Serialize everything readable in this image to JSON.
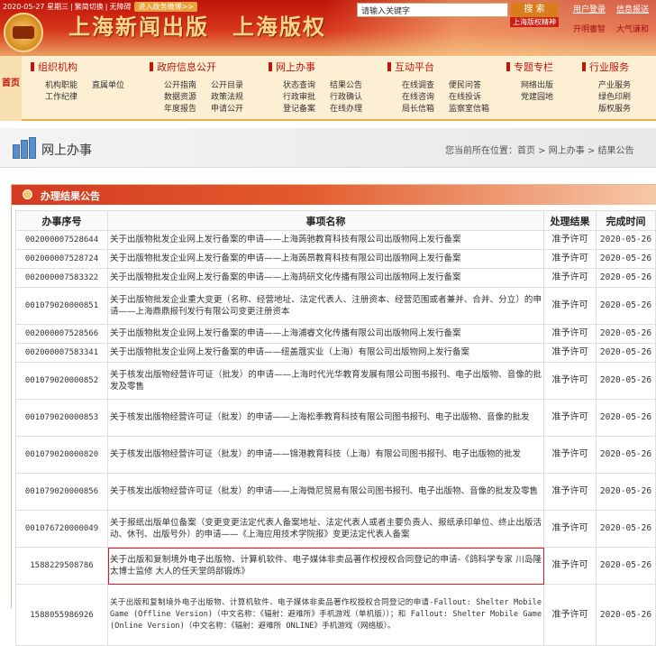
{
  "header": {
    "date_line": "2020-05-27 星期三",
    "lang_switch": "繁简切换",
    "accessible": "无障碍",
    "gov_entry": "进入政务微博>>",
    "title_publish": "上海新闻出版",
    "title_copyright": "上海版权",
    "search_placeholder": "请输入关键字",
    "search_button": "搜 索",
    "book_wall": "上海版权精神",
    "top_links": [
      "用户登录",
      "信息报送",
      "开明書智",
      "大气谦和"
    ]
  },
  "nav": {
    "home": "首页",
    "groups": [
      {
        "title": "组织机构",
        "links": [
          "机构职能",
          "直属单位",
          "工作纪律"
        ]
      },
      {
        "title": "政府信息公开",
        "links": [
          "公开指南",
          "公开目录",
          "数据资源",
          "政策法规",
          "年度报告",
          "申请公开"
        ]
      },
      {
        "title": "网上办事",
        "links": [
          "状态查询",
          "结果公告",
          "行政审批",
          "行政确认",
          "登记备案",
          "在线办理"
        ]
      },
      {
        "title": "互动平台",
        "links": [
          "在线调查",
          "便民问答",
          "在线咨询",
          "在线投诉",
          "局长信箱",
          "监察室信箱"
        ]
      },
      {
        "title": "专题专栏",
        "links": [
          "网络出版",
          "党建园地"
        ]
      },
      {
        "title": "行业服务",
        "links": [
          "产业服务",
          "绿色印刷",
          "版权服务"
        ]
      }
    ]
  },
  "location": {
    "title": "网上办事",
    "crumb_prefix": "您当前所在位置：",
    "crumbs": [
      "首页",
      "网上办事",
      "结果公告"
    ],
    "crumb_sep": " > "
  },
  "panel": {
    "title": "办理结果公告",
    "columns": [
      "办事序号",
      "事项名称",
      "处理结果",
      "完成时间"
    ],
    "rows": [
      {
        "id": "002000007528644",
        "name": "关于出版物批发企业网上发行备案的申请——上海蒟驰教育科技有限公司出版物网上发行备案",
        "result": "准予许可",
        "date": "2020-05-26"
      },
      {
        "id": "002000007528724",
        "name": "关于出版物批发企业网上发行备案的申请——上海蒟昂教育科技有限公司出版物网上发行备案",
        "result": "准予许可",
        "date": "2020-05-26"
      },
      {
        "id": "002000007583322",
        "name": "关于出版物批发企业网上发行备案的申请——上海鸪研文化传播有限公司出版物网上发行备案",
        "result": "准予许可",
        "date": "2020-05-26"
      },
      {
        "id": "001079020000851",
        "name": "关于出版物批发企业重大变更（名称、经营地址、法定代表人、注册资本、经营范围或者兼并、合并、分立）的申请——上海鼎鼎报刊发行有限公司变更注册资本",
        "result": "准予许可",
        "date": "2020-05-26"
      },
      {
        "id": "002000007528566",
        "name": "关于出版物批发企业网上发行备案的申请——上海浦睿文化传播有限公司出版物网上发行备案",
        "result": "准予许可",
        "date": "2020-05-26"
      },
      {
        "id": "002000007583341",
        "name": "关于出版物批发企业网上发行备案的申请——纽盖蔻实业（上海）有限公司出版物网上发行备案",
        "result": "准予许可",
        "date": "2020-05-26"
      },
      {
        "id": "001079020000852",
        "name": "关于核发出版物经营许可证（批发）的申请——上海时代光华教育发展有限公司图书报刊、电子出版物、音像的批发及零售",
        "result": "准予许可",
        "date": "2020-05-26"
      },
      {
        "id": "001079020000853",
        "name": "关于核发出版物经营许可证（批发）的申请——上海松季教育科技有限公司图书报刊、电子出版物、音像的批发",
        "result": "准予许可",
        "date": "2020-05-26"
      },
      {
        "id": "001079020000820",
        "name": "关于核发出版物经营许可证（批发）的申请——锦港教育科技（上海）有限公司图书报刊、电子出版物的批发",
        "result": "准予许可",
        "date": "2020-05-26"
      },
      {
        "id": "001079020000856",
        "name": "关于核发出版物经营许可证（批发）的申请——上海微尼贸易有限公司图书报刊、电子出版物、音像的批发及零售",
        "result": "准予许可",
        "date": "2020-05-26"
      },
      {
        "id": "001076720000049",
        "name": "关于报纸出版单位备案（变更变更法定代表人备案地址、法定代表人或者主要负责人、报纸承印单位、终止出版活动、休刊、出版号外）的申请——《上海应用技术学院报》变更法定代表人备案",
        "result": "准予许可",
        "date": "2020-05-26"
      },
      {
        "id": "1588229508786",
        "name": "关于出版和复制境外电子出版物、计算机软件、电子媒体非卖品著作权授权合同登记的申请-《鸽科学专家 川岛隆太博士监修 大人的任天堂鸽部锻炼》",
        "result": "准予许可",
        "date": "2020-05-26",
        "highlight": true
      },
      {
        "id": "1588055986926",
        "name": "关于出版和复制境外电子出版物、计算机软件、电子媒体非卖品著作权授权合同登记的申请-Fallout: Shelter Mobile Game (Offline Version)（中文名称：《辐射：避难所》手机游戏（单机版））；和 Fallout: Shelter Mobile Game (Online Version)（中文名称：《辐射：避难所 ONLINE》手机游戏（网络版）。",
        "result": "准予许可",
        "date": "2020-05-26",
        "mono": true
      }
    ]
  },
  "colors": {
    "brand_red": "#c5140c",
    "header_gold": "#f6d88a",
    "highlight_border": "#d8191d"
  }
}
